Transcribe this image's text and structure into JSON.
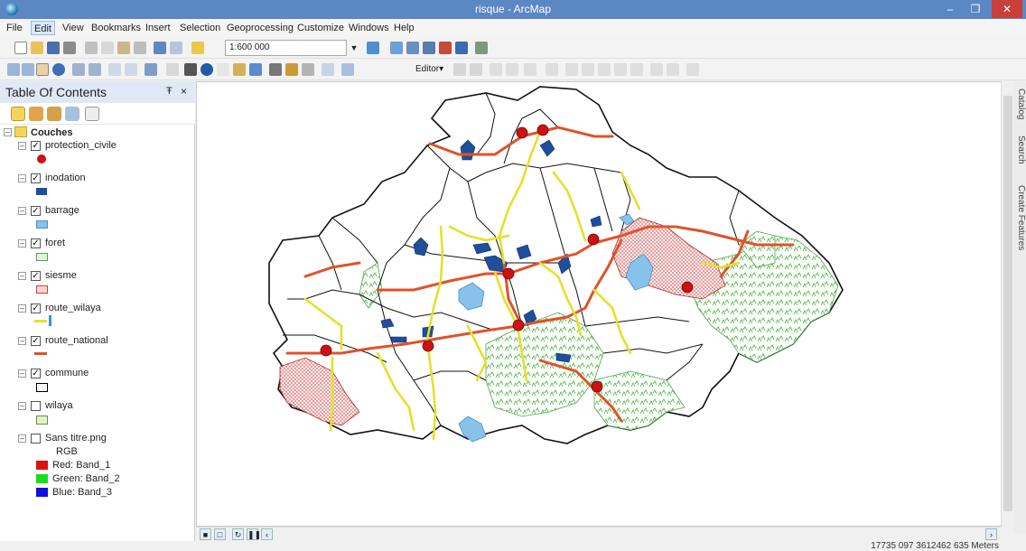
{
  "window": {
    "title": "risque - ArcMap"
  },
  "menu": [
    "File",
    "Edit",
    "View",
    "Bookmarks",
    "Insert",
    "Selection",
    "Geoprocessing",
    "Customize",
    "Windows",
    "Help"
  ],
  "toolbar": {
    "scale": "1:600 000",
    "editor_label": "Editor▾"
  },
  "toc": {
    "title": "Table Of Contents",
    "pin": "Ŧ",
    "close": "×",
    "root": "Couches",
    "layers": [
      {
        "name": "protection_civile",
        "checked": true
      },
      {
        "name": "inodation",
        "checked": true
      },
      {
        "name": "barrage",
        "checked": true
      },
      {
        "name": "foret",
        "checked": true
      },
      {
        "name": "siesme",
        "checked": true
      },
      {
        "name": "route_wilaya",
        "checked": true
      },
      {
        "name": "route_national",
        "checked": true
      },
      {
        "name": "commune",
        "checked": true
      },
      {
        "name": "wilaya",
        "checked": false
      },
      {
        "name": "Sans titre.png",
        "checked": false
      }
    ],
    "rgb": {
      "label": "RGB",
      "bands": [
        {
          "label": "Red:   Band_1",
          "color": "#e01010"
        },
        {
          "label": "Green: Band_2",
          "color": "#18e018"
        },
        {
          "label": "Blue:  Band_3",
          "color": "#1010e0"
        }
      ]
    }
  },
  "side_tabs": [
    "Catalog",
    "Search",
    "Create Features"
  ],
  "status": {
    "coordinates": "17735 097  3612462 635 Meters"
  },
  "colors": {
    "titlebar": "#5b87c5",
    "protection_civile": "#cc1111",
    "inodation": "#1f4e9a",
    "barrage": "#87c2ea",
    "foret": "#4aa84a",
    "siesme": "#d23a3a",
    "route_wilaya": "#e6e02a",
    "route_national": "#e0522a"
  }
}
